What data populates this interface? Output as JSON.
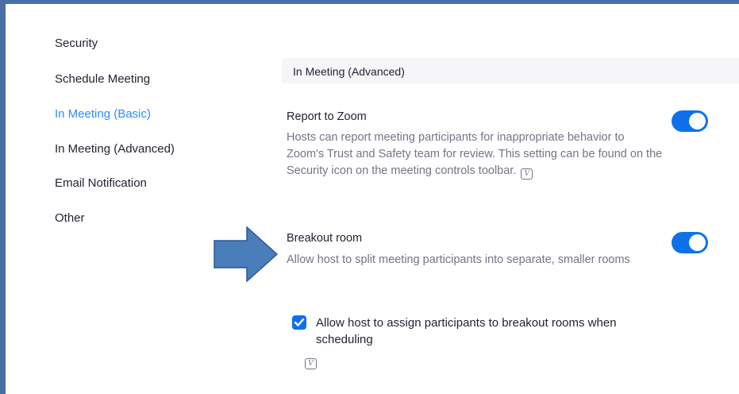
{
  "sidebar": {
    "items": [
      {
        "label": "Security"
      },
      {
        "label": "Schedule Meeting"
      },
      {
        "label": "In Meeting (Basic)"
      },
      {
        "label": "In Meeting (Advanced)"
      },
      {
        "label": "Email Notification"
      },
      {
        "label": "Other"
      }
    ],
    "active_index": 2
  },
  "section": {
    "title": "In Meeting (Advanced)"
  },
  "settings": {
    "report": {
      "title": "Report to Zoom",
      "description": "Hosts can report meeting participants for inappropriate behavior to Zoom's Trust and Safety team for review. This setting can be found on the Security icon on the meeting controls toolbar.",
      "enabled": true
    },
    "breakout": {
      "title": "Breakout room",
      "description": "Allow host to split meeting participants into separate, smaller rooms",
      "enabled": true,
      "option_label": "Allow host to assign participants to breakout rooms when scheduling",
      "option_checked": true
    }
  },
  "icons": {
    "version_icon_glyph": "V",
    "arrow_color": "#4a7ebb",
    "accent": "#0e71eb",
    "active_nav": "#2d8cff",
    "frame_border": "#4a6fa5"
  }
}
